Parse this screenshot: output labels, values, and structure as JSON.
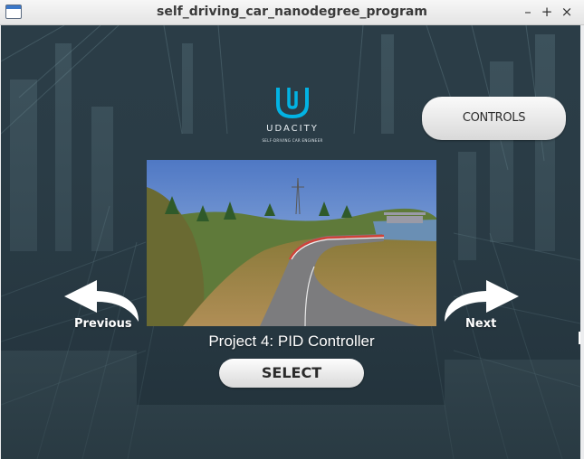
{
  "window": {
    "title": "self_driving_car_nanodegree_program",
    "minimize_glyph": "–",
    "maximize_glyph": "+",
    "close_glyph": "×"
  },
  "logo": {
    "brand": "UDACITY",
    "subtitle": "SELF-DRIVING CAR ENGINEER",
    "accent_color": "#02b3e4"
  },
  "controls_button": {
    "label": "CONTROLS"
  },
  "navigation": {
    "previous_label": "Previous",
    "next_label": "Next"
  },
  "project": {
    "title": "Project 4: PID Controller"
  },
  "select_button": {
    "label": "SELECT"
  },
  "icons": {
    "app": "window-icon",
    "previous": "curved-arrow-left-icon",
    "next": "curved-arrow-right-icon"
  }
}
